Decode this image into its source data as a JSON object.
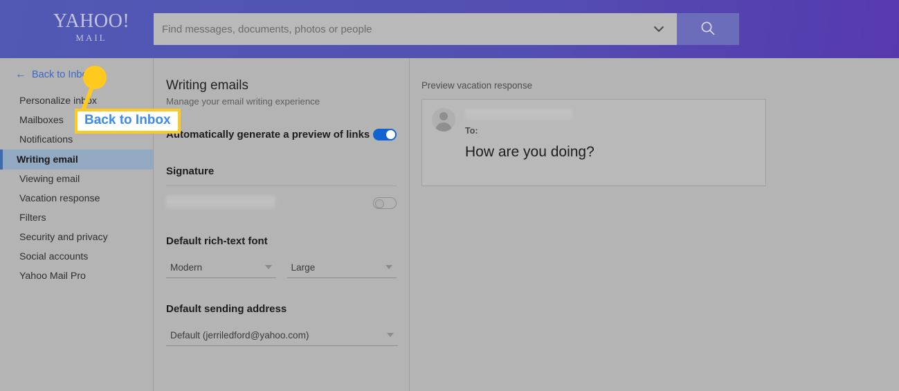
{
  "header": {
    "logo_main": "YAHOO!",
    "logo_sub": "MAIL",
    "search_placeholder": "Find messages, documents, photos or people",
    "search_value": "",
    "chevron_icon": "chevron-down-icon",
    "search_icon": "search-icon",
    "accent_color": "#5350b2",
    "search_button_color": "#6b6cba"
  },
  "sidebar": {
    "back_label": "Back to Inbox",
    "back_arrow_icon": "arrow-left-icon",
    "back_link_color": "#3b68c4",
    "selected_item": "Writing email",
    "items": [
      {
        "label": "Personalize inbox",
        "selected": false
      },
      {
        "label": "Mailboxes",
        "selected": false
      },
      {
        "label": "Notifications",
        "selected": false
      },
      {
        "label": "Writing email",
        "selected": true
      },
      {
        "label": "Viewing email",
        "selected": false
      },
      {
        "label": "Vacation response",
        "selected": false
      },
      {
        "label": "Filters",
        "selected": false
      },
      {
        "label": "Security and privacy",
        "selected": false
      },
      {
        "label": "Social accounts",
        "selected": false
      },
      {
        "label": "Yahoo Mail Pro",
        "selected": false
      }
    ]
  },
  "main": {
    "title": "Writing emails",
    "subtitle": "Manage your email writing experience",
    "link_preview": {
      "label": "Automatically generate a preview of links",
      "toggle_state": "on",
      "toggle_on_color": "#1263d2"
    },
    "signature": {
      "heading": "Signature",
      "value": "",
      "toggle_state": "off"
    },
    "rich_text_font": {
      "heading": "Default rich-text font",
      "font_value": "Modern",
      "size_value": "Large",
      "caret_icon": "caret-down-icon"
    },
    "sending_address": {
      "heading": "Default sending address",
      "value": "Default (jerriledford@yahoo.com)",
      "caret_icon": "caret-down-icon"
    }
  },
  "preview": {
    "label": "Preview vacation response",
    "avatar_icon": "avatar-icon",
    "sender": "",
    "to_label": "To:",
    "body": "How are you doing?"
  },
  "annotation": {
    "callout_text": "Back to Inbox",
    "marker_color": "#ffc91e",
    "text_color": "#3b8bf0"
  }
}
